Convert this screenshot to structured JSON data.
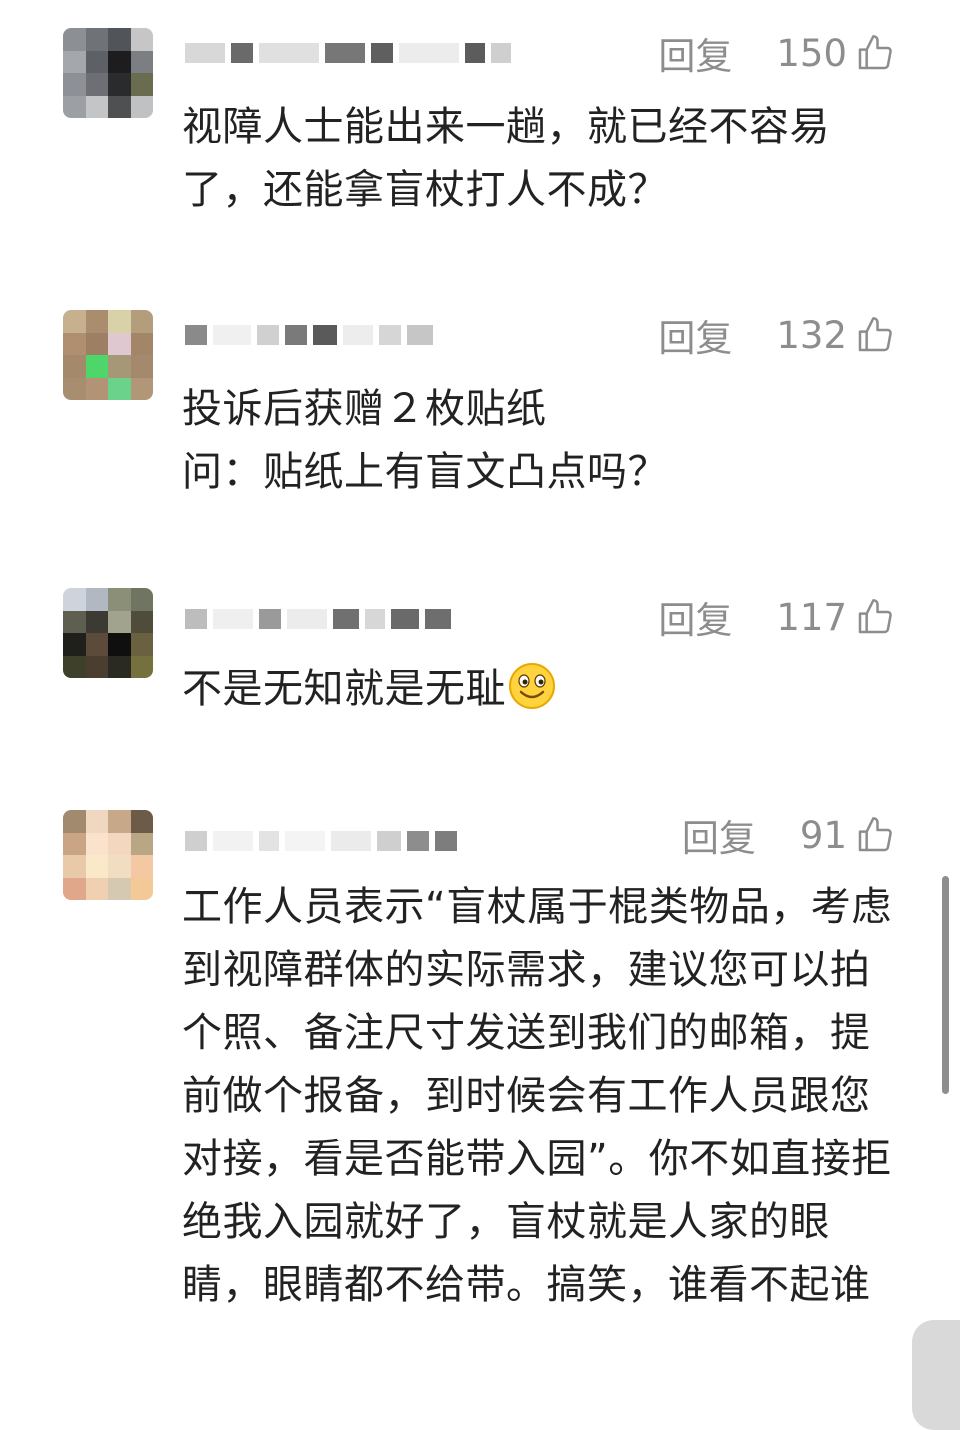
{
  "comments": [
    {
      "reply_label": "回复",
      "likes": "150",
      "text": "视障人士能出来一趟，就已经不容易了，还能拿盲杖打人不成？"
    },
    {
      "reply_label": "回复",
      "likes": "132",
      "text": "投诉后获赠２枚贴纸\n问：贴纸上有盲文凸点吗？"
    },
    {
      "reply_label": "回复",
      "likes": "117",
      "text": "不是无知就是无耻",
      "emoji": "smile-emoji"
    },
    {
      "reply_label": "回复",
      "likes": "91",
      "text": "工作人员表示“盲杖属于棍类物品，考虑到视障群体的实际需求，建议您可以拍个照、备注尺寸发送到我们的邮箱，提前做个报备，到时候会有工作人员跟您对接，看是否能带入园”。你不如直接拒绝我入园就好了，盲杖就是人家的眼睛，眼睛都不给带。搞笑，谁看不起谁"
    }
  ],
  "colors": {
    "meta_text": "#8d8d8d",
    "body_text": "#222222",
    "scrollbar": "#8e8e8e"
  },
  "icons": {
    "like": "thumbs-up-icon"
  }
}
